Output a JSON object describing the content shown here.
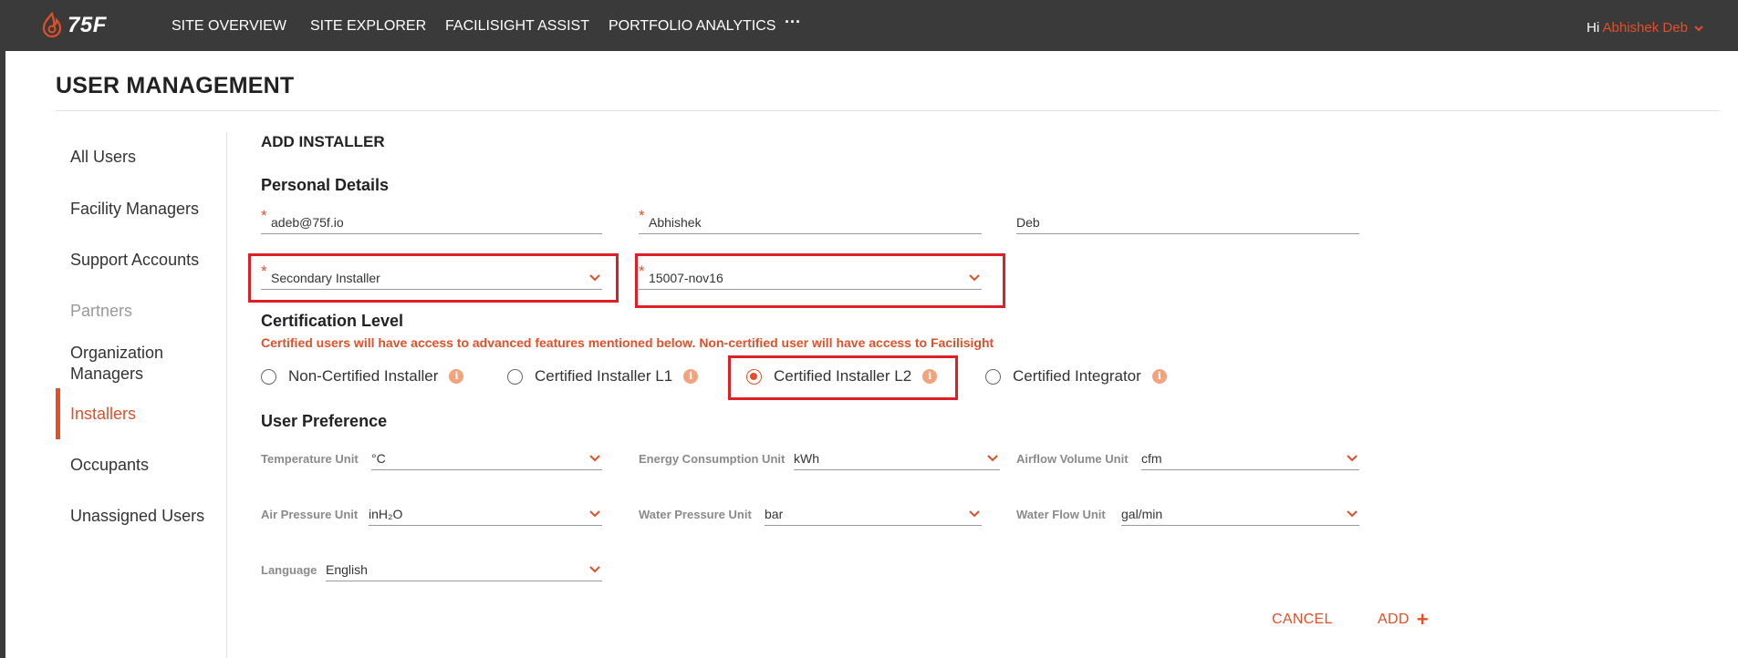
{
  "topnav": {
    "logo_text": "75F",
    "items": [
      "SITE OVERVIEW",
      "SITE EXPLORER",
      "FACILISIGHT ASSIST",
      "PORTFOLIO ANALYTICS"
    ],
    "more": "···",
    "greeting": "Hi",
    "user_name": "Abhishek Deb"
  },
  "page": {
    "title": "USER MANAGEMENT"
  },
  "sidebar": {
    "items": [
      {
        "label": "All Users"
      },
      {
        "label": "Facility Managers"
      },
      {
        "label": "Support Accounts"
      },
      {
        "label": "Partners"
      },
      {
        "label": "Organization Managers"
      },
      {
        "label": "Installers"
      },
      {
        "label": "Occupants"
      },
      {
        "label": "Unassigned Users"
      }
    ],
    "active": "Installers"
  },
  "form": {
    "heading": "ADD INSTALLER",
    "personal_details": {
      "heading": "Personal Details",
      "email": "adeb@75f.io",
      "first_name": "Abhishek",
      "last_name": "Deb",
      "role": "Secondary Installer",
      "site": "15007-nov16",
      "required_mark": "*"
    },
    "certification": {
      "heading": "Certification Level",
      "note": "Certified users will have access to advanced features mentioned below. Non-certified user will have access to Facilisight",
      "options": [
        "Non-Certified Installer",
        "Certified Installer L1",
        "Certified Installer L2",
        "Certified Integrator"
      ],
      "selected": "Certified Installer L2",
      "info_glyph": "i"
    },
    "preferences": {
      "heading": "User Preference",
      "temperature_unit": {
        "label": "Temperature Unit",
        "value": "°C"
      },
      "energy_unit": {
        "label": "Energy Consumption Unit",
        "value": "kWh"
      },
      "airflow_unit": {
        "label": "Airflow Volume Unit",
        "value": "cfm"
      },
      "air_pressure_unit": {
        "label": "Air Pressure Unit",
        "value": "inH₂O"
      },
      "water_pressure_unit": {
        "label": "Water Pressure Unit",
        "value": "bar"
      },
      "water_flow_unit": {
        "label": "Water Flow Unit",
        "value": "gal/min"
      },
      "language": {
        "label": "Language",
        "value": "English"
      }
    },
    "actions": {
      "cancel": "CANCEL",
      "add": "ADD",
      "add_icon": "+"
    }
  },
  "colors": {
    "accent": "#e24f28",
    "nav_bg": "#3a3a3a",
    "highlight": "#e01e26"
  }
}
